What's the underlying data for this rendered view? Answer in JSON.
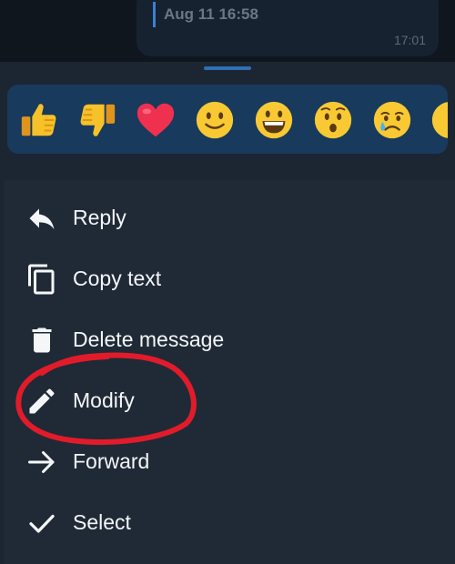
{
  "chat": {
    "quote_text": "Aug 11 16:58",
    "time": "17:01"
  },
  "reactions": [
    {
      "name": "thumbs-up"
    },
    {
      "name": "thumbs-down"
    },
    {
      "name": "red-heart"
    },
    {
      "name": "slightly-smiling-face"
    },
    {
      "name": "grinning-face"
    },
    {
      "name": "hushed-face"
    },
    {
      "name": "crying-face"
    }
  ],
  "menu": {
    "items": [
      {
        "label": "Reply",
        "icon": "reply-icon"
      },
      {
        "label": "Copy text",
        "icon": "copy-icon"
      },
      {
        "label": "Delete message",
        "icon": "trash-icon"
      },
      {
        "label": "Modify",
        "icon": "pencil-icon"
      },
      {
        "label": "Forward",
        "icon": "arrow-right-icon"
      },
      {
        "label": "Select",
        "icon": "check-icon"
      }
    ]
  },
  "colors": {
    "background": "#1c2632",
    "reaction_bar": "#173a5d",
    "annotation": "#e21b2a",
    "text": "#f4f6f8"
  }
}
